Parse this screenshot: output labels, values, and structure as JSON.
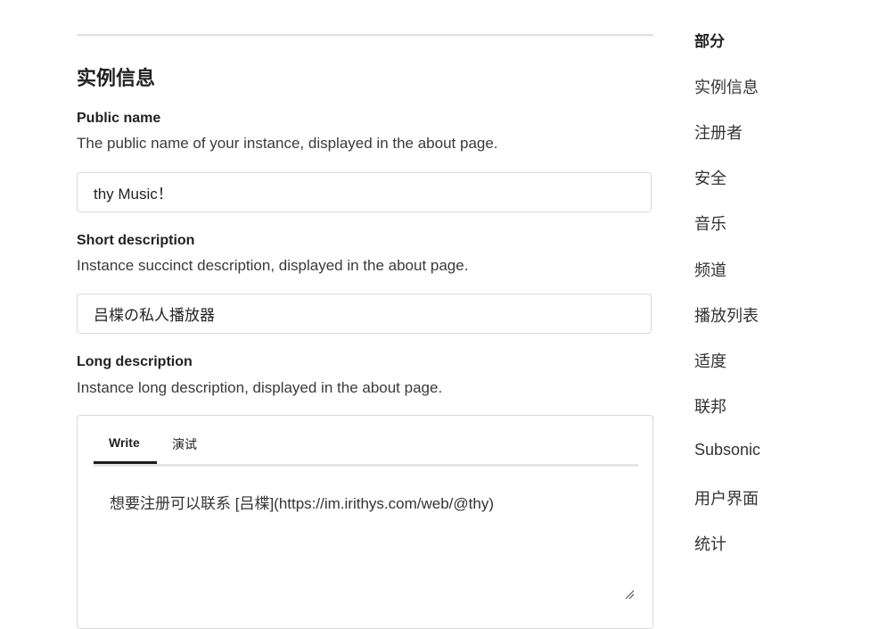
{
  "section": {
    "title": "实例信息"
  },
  "fields": {
    "public_name": {
      "label": "Public name",
      "help": "The public name of your instance, displayed in the about page.",
      "value": "thy Music！"
    },
    "short_description": {
      "label": "Short description",
      "help": "Instance succinct description, displayed in the about page.",
      "value": "吕楪の私人播放器"
    },
    "long_description": {
      "label": "Long description",
      "help": "Instance long description, displayed in the about page.",
      "tabs": {
        "write": "Write",
        "preview": "演试"
      },
      "active_tab": "Write",
      "value": "想要注册可以联系 [吕楪](https://im.irithys.com/web/@thy)"
    }
  },
  "sidebar": {
    "heading": "部分",
    "items": [
      {
        "label": "实例信息"
      },
      {
        "label": "注册者"
      },
      {
        "label": "安全"
      },
      {
        "label": "音乐"
      },
      {
        "label": "频道"
      },
      {
        "label": "播放列表"
      },
      {
        "label": "适度"
      },
      {
        "label": "联邦"
      },
      {
        "label": "Subsonic"
      },
      {
        "label": "用户界面"
      },
      {
        "label": "统计"
      }
    ]
  },
  "icons": {
    "resize": "resize-handle-icon"
  }
}
